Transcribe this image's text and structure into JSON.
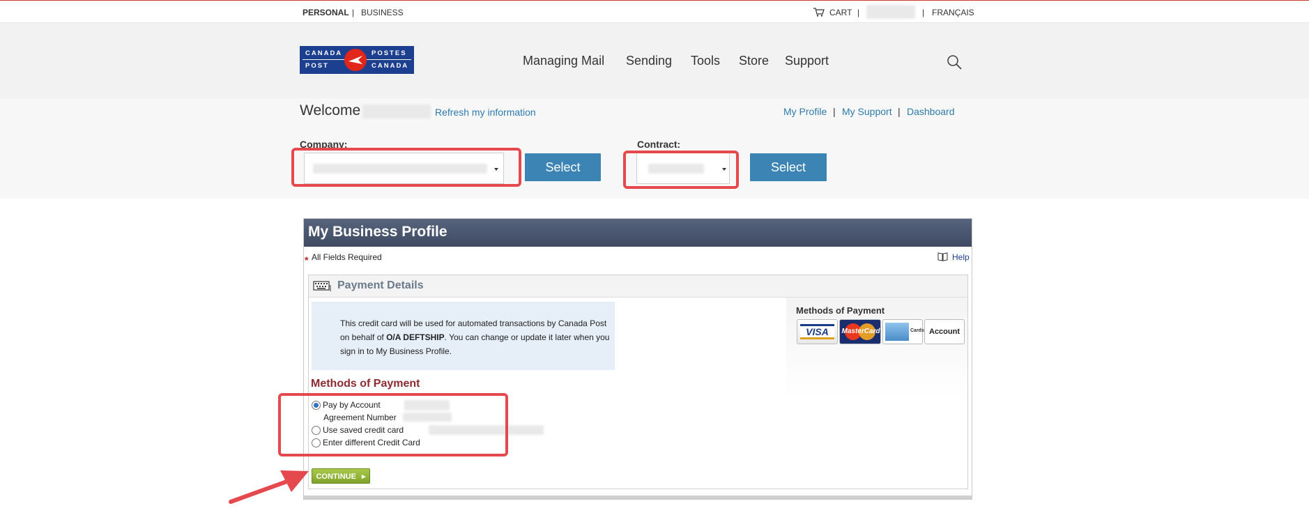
{
  "topbar": {
    "personal": "PERSONAL",
    "business": "BUSINESS",
    "cart": "CART",
    "francais": "FRANÇAIS",
    "pipe": "|"
  },
  "logo": {
    "canada": "CANADA",
    "postes": "POSTES",
    "post": "POST",
    "canada2": "CANADA"
  },
  "nav": [
    "Managing Mail",
    "Sending",
    "Tools",
    "Store",
    "Support"
  ],
  "welcome": {
    "greeting": "Welcome",
    "refresh": "Refresh my information"
  },
  "account_links": {
    "profile": "My Profile",
    "support": "My Support",
    "dashboard": "Dashboard",
    "pipe": "|"
  },
  "selectors": {
    "company_label": "Company:",
    "contract_label": "Contract:",
    "select_label": "Select"
  },
  "profile": {
    "title": "My Business Profile",
    "required_star": "*",
    "required": "All Fields Required",
    "help": "Help",
    "payment_details": "Payment Details",
    "info_pre": "This credit card will be used for automated transactions by Canada Post on behalf of ",
    "info_company": "O/A DEFTSHIP",
    "info_post": ". You can change or update it later when you sign in to My Business Profile.",
    "methods_right_title": "Methods of Payment",
    "cards": {
      "visa": "VISA",
      "mastercard": "MasterCard",
      "amex_cards": "Cards",
      "account": "Account"
    },
    "methods_title": "Methods of Payment",
    "options": {
      "pay_by_account": "Pay by Account",
      "agreement_number": "Agreement Number",
      "saved_card": "Use saved credit card",
      "different_card": "Enter different Credit Card"
    },
    "continue": "CONTINUE"
  },
  "colors": {
    "brand_red": "#e1261c",
    "brand_blue": "#1d3f8f",
    "button_blue": "#3b84b4",
    "highlight_red": "#e5484d",
    "profile_header": "#3e4a62",
    "methods_title": "#8b2a2f"
  }
}
